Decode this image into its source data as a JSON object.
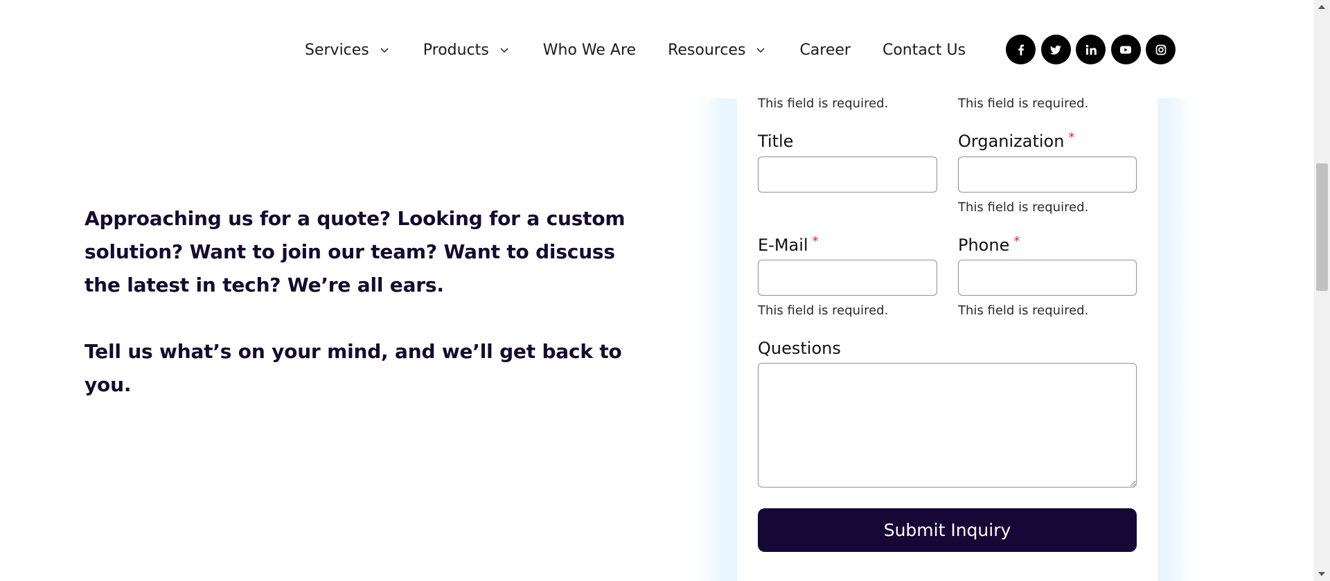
{
  "nav": {
    "items": [
      {
        "label": "Services",
        "has_dropdown": true
      },
      {
        "label": "Products",
        "has_dropdown": true
      },
      {
        "label": "Who We Are",
        "has_dropdown": false
      },
      {
        "label": "Resources",
        "has_dropdown": true
      },
      {
        "label": "Career",
        "has_dropdown": false
      },
      {
        "label": "Contact Us",
        "has_dropdown": false
      }
    ]
  },
  "social": {
    "icons": [
      "facebook-icon",
      "twitter-icon",
      "linkedin-icon",
      "youtube-icon",
      "instagram-icon"
    ]
  },
  "intro": {
    "paragraph1": "Approaching us for a quote? Looking for a custom solution? Want to join our team? Want to discuss the latest in tech? We’re all ears.",
    "paragraph2": "Tell us what’s on your mind, and we’ll get back to you."
  },
  "form": {
    "required_marker": "*",
    "error_text": "This field is required.",
    "title": {
      "label": "Title",
      "value": ""
    },
    "organization": {
      "label": "Organization",
      "value": ""
    },
    "email": {
      "label": "E-Mail",
      "value": ""
    },
    "phone": {
      "label": "Phone",
      "value": ""
    },
    "questions": {
      "label": "Questions",
      "value": ""
    },
    "submit_label": "Submit Inquiry"
  },
  "colors": {
    "heading_text": "#150a30",
    "button_bg": "#170737",
    "required_star": "#e02424",
    "card_glow": "#e9f6ff"
  }
}
